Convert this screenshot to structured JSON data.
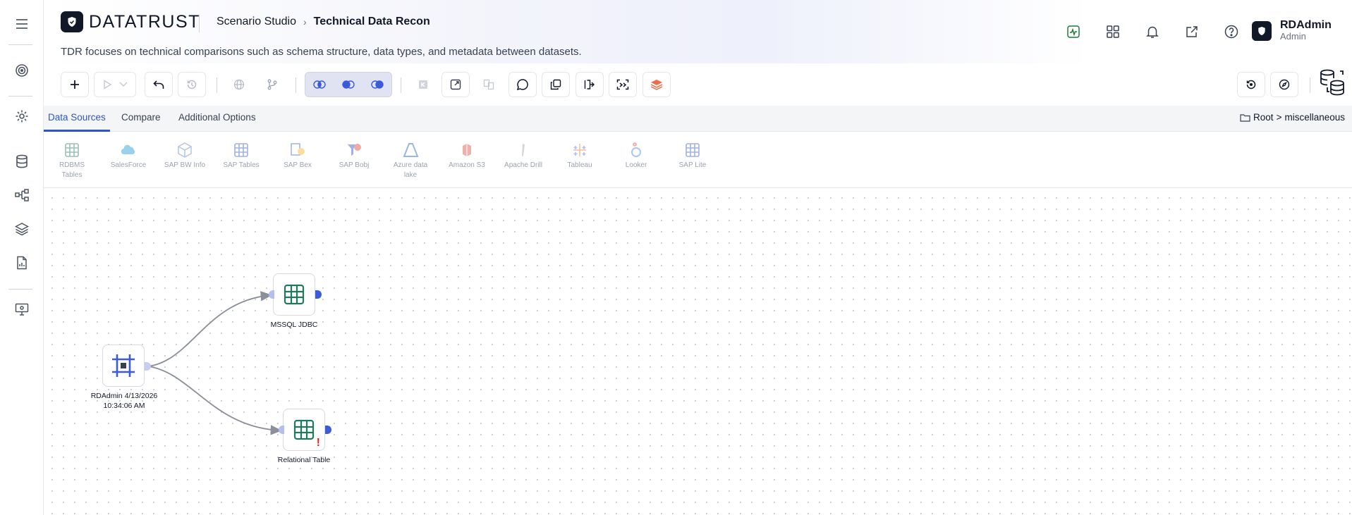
{
  "header": {
    "brand": "DATATRUST",
    "breadcrumb": [
      "Scenario Studio",
      "Technical Data Recon"
    ],
    "description": "TDR focuses on technical comparisons such as schema structure, data types, and metadata between datasets.",
    "icons": [
      "activity-icon",
      "apps-grid-icon",
      "bell-icon",
      "external-link-icon",
      "help-icon"
    ],
    "user": {
      "name": "RDAdmin",
      "role": "Admin"
    }
  },
  "sidebar": {
    "items": [
      "menu-icon",
      "target-icon",
      "gear-icon",
      "database-icon",
      "lineage-icon",
      "layers-icon",
      "report-icon",
      "monitor-settings-icon"
    ]
  },
  "toolbar": {
    "buttons": [
      "add-icon",
      "run-icon",
      "dropdown-icon",
      "undo-icon",
      "history-icon",
      "globe-icon",
      "branch-icon",
      "join-inner-icon",
      "join-left-icon",
      "join-right-icon",
      "skip-icon",
      "export-icon",
      "compare-icon",
      "comment-icon",
      "copy-icon",
      "split-icon",
      "scan-icon",
      "layers-stack-icon",
      "restore-icon",
      "compass-icon",
      "datasets-icon"
    ]
  },
  "tabs": {
    "items": [
      "Data Sources",
      "Compare",
      "Additional Options"
    ],
    "active": "Data Sources",
    "path": {
      "root": "Root",
      "sep": ">",
      "folder": "miscellaneous"
    }
  },
  "palette": {
    "items": [
      {
        "label": "RDBMS Tables",
        "icon": "table-icon"
      },
      {
        "label": "SalesForce",
        "icon": "cloud-icon"
      },
      {
        "label": "SAP BW Info",
        "icon": "cube-icon"
      },
      {
        "label": "SAP Tables",
        "icon": "table-icon"
      },
      {
        "label": "SAP Bex",
        "icon": "bex-icon"
      },
      {
        "label": "SAP Bobj",
        "icon": "bobj-icon"
      },
      {
        "label": "Azure data lake",
        "icon": "azure-icon"
      },
      {
        "label": "Amazon S3",
        "icon": "s3-icon"
      },
      {
        "label": "Apache Drill",
        "icon": "drill-icon"
      },
      {
        "label": "Tableau",
        "icon": "tableau-icon"
      },
      {
        "label": "Looker",
        "icon": "looker-icon"
      },
      {
        "label": "SAP Lite",
        "icon": "table-icon"
      }
    ]
  },
  "canvas": {
    "nodes": [
      {
        "id": "source",
        "label": "RDAdmin 4/13/2026 10:34:06 AM",
        "icon": "frame-icon"
      },
      {
        "id": "mssql",
        "label": "MSSQL JDBC",
        "icon": "table-icon"
      },
      {
        "id": "relational",
        "label": "Relational Table",
        "icon": "table-icon",
        "status": "!"
      }
    ],
    "edges": [
      [
        "source",
        "mssql"
      ],
      [
        "source",
        "relational"
      ]
    ]
  },
  "colors": {
    "accent": "#2f55c8",
    "node_icon": "#1f7a5a",
    "warning": "#dc2626",
    "port": "#3b5bdb"
  }
}
